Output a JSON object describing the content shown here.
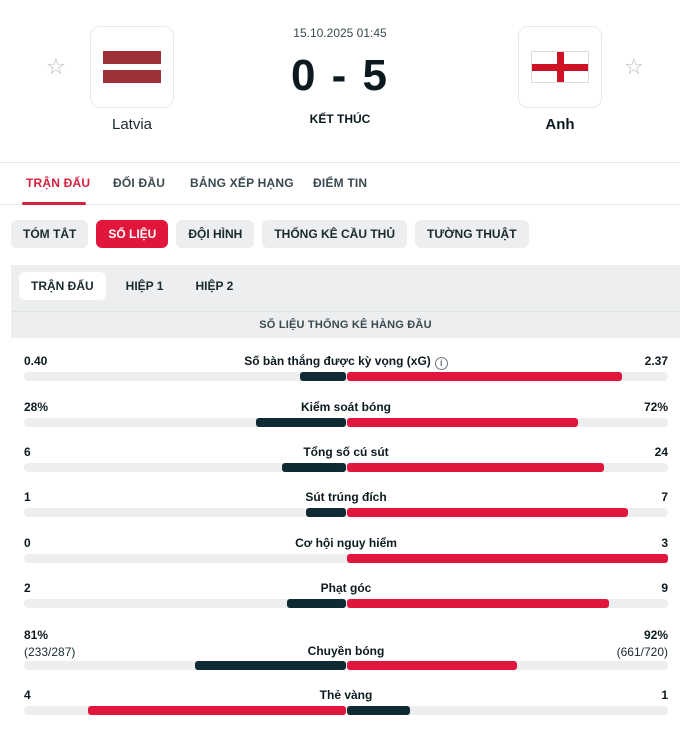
{
  "match": {
    "datetime": "15.10.2025 01:45",
    "score": "0 - 5",
    "status": "KẾT THÚC",
    "home_team": "Latvia",
    "away_team": "Anh",
    "home_flag": "latvia-flag",
    "away_flag": "england-flag"
  },
  "main_tabs": [
    "TRẬN ĐẤU",
    "ĐỐI ĐẦU",
    "BẢNG XẾP HẠNG",
    "ĐIỂM TIN"
  ],
  "sub_tabs": [
    "TÓM TẮT",
    "SỐ LIỆU",
    "ĐỘI HÌNH",
    "THỐNG KÊ CẦU THỦ",
    "TƯỜNG THUẬT"
  ],
  "period_tabs": [
    "TRẬN ĐẤU",
    "HIỆP 1",
    "HIỆP 2"
  ],
  "section_title": "SỐ LIỆU THỐNG KÊ HÀNG ĐẦU",
  "colors": {
    "accent": "#e0163c",
    "home_bar": "#0f2a33",
    "active_tab_text": "#d4213f"
  },
  "stats": [
    {
      "label": "Số bàn thắng được kỳ vọng (xG)",
      "home": "0.40",
      "away": "2.37",
      "home_share": 0.144,
      "away_share": 0.856,
      "info": true
    },
    {
      "label": "Kiểm soát bóng",
      "home": "28%",
      "away": "72%",
      "home_share": 0.28,
      "away_share": 0.72
    },
    {
      "label": "Tổng số cú sút",
      "home": "6",
      "away": "24",
      "home_share": 0.2,
      "away_share": 0.8
    },
    {
      "label": "Sút trúng đích",
      "home": "1",
      "away": "7",
      "home_share": 0.125,
      "away_share": 0.875
    },
    {
      "label": "Cơ hội nguy hiểm",
      "home": "0",
      "away": "3",
      "home_share": 0.0,
      "away_share": 1.0
    },
    {
      "label": "Phạt góc",
      "home": "2",
      "away": "9",
      "home_share": 0.182,
      "away_share": 0.818
    },
    {
      "label": "Chuyền bóng",
      "home": "81%",
      "away": "92%",
      "home_sub": "(233/287)",
      "away_sub": "(661/720)",
      "home_share": 0.47,
      "away_share": 0.53
    },
    {
      "label": "Thẻ vàng",
      "home": "4",
      "away": "1",
      "home_share": 0.8,
      "away_share": 0.2,
      "home_color": "#e0163c",
      "away_color": "#0f2a33"
    }
  ]
}
